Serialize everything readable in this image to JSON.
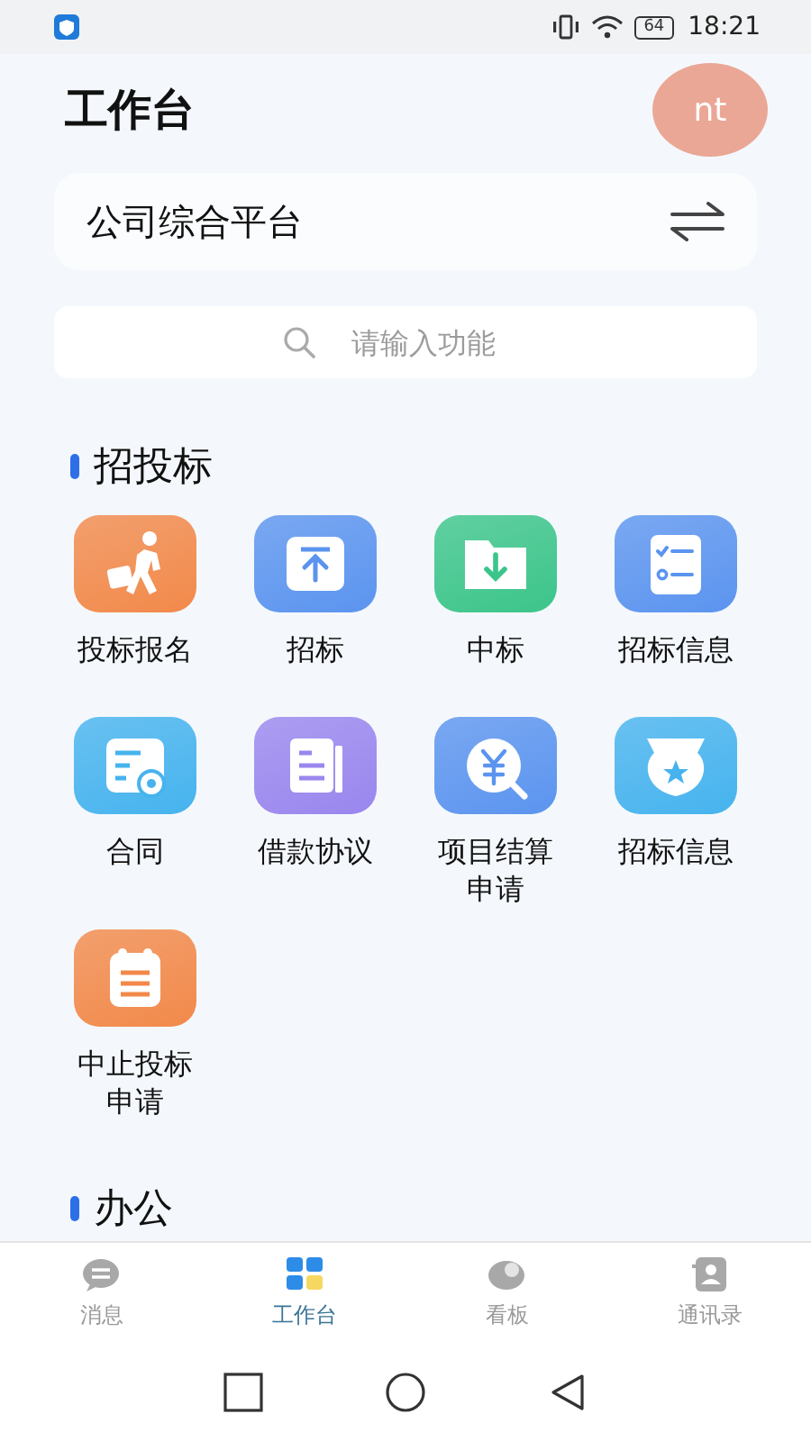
{
  "status_bar": {
    "battery": "64",
    "time": "18:21"
  },
  "header": {
    "title": "工作台",
    "avatar": "nt"
  },
  "platform": {
    "name": "公司综合平台"
  },
  "search": {
    "placeholder": "请输入功能"
  },
  "sections": [
    {
      "title": "招投标",
      "items": [
        {
          "label": "投标报名",
          "color": "#f2894a"
        },
        {
          "label": "招标",
          "color": "#5b94ef"
        },
        {
          "label": "中标",
          "color": "#3cc58a"
        },
        {
          "label": "招标信息",
          "color": "#5b94ef"
        },
        {
          "label": "合同",
          "color": "#46b3ee"
        },
        {
          "label": "借款协议",
          "color": "#9a86ee"
        },
        {
          "label": "项目结算申请",
          "color": "#5b94ef"
        },
        {
          "label": "招标信息",
          "color": "#46b3ee"
        },
        {
          "label": "中止投标申请",
          "color": "#f2894a"
        }
      ]
    },
    {
      "title": "办公"
    }
  ],
  "tabs": [
    {
      "label": "消息",
      "selected": false
    },
    {
      "label": "工作台",
      "selected": true
    },
    {
      "label": "看板",
      "selected": false
    },
    {
      "label": "通讯录",
      "selected": false
    }
  ]
}
